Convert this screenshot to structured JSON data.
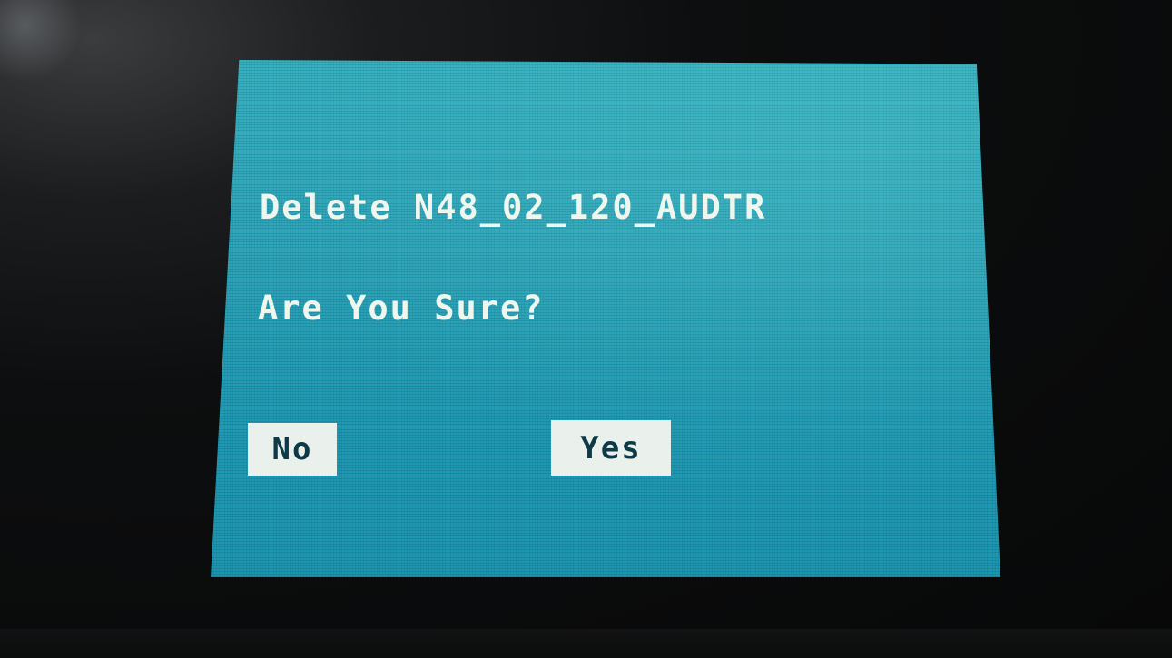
{
  "dialog": {
    "delete_message": "Delete N48_02_120_AUDTR",
    "confirm_message": "Are You Sure?",
    "no_label": "No",
    "yes_label": "Yes"
  },
  "colors": {
    "screen_background": "#2ea6bb",
    "text": "#eef6ee",
    "button_background": "#eaf1ec",
    "button_text": "#0e3a48",
    "device_body": "#0b0c0d"
  }
}
